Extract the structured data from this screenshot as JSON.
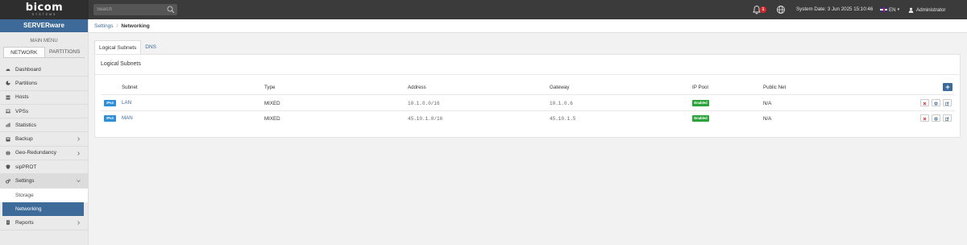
{
  "logo": {
    "main": "bicom",
    "sub": "SYSTEMS"
  },
  "search": {
    "placeholder": "Search"
  },
  "notifications": {
    "count": "1"
  },
  "system_date": "System Date: 3 Jun 2025 15:10:46",
  "language": {
    "label": "EN"
  },
  "user": {
    "name": "Administrator"
  },
  "sidebar": {
    "brand": "SERVERware",
    "main_menu": "MAIN MENU",
    "tabs": [
      {
        "label": "NETWORK"
      },
      {
        "label": "PARTITIONS"
      }
    ],
    "items": [
      {
        "label": "Dashboard",
        "icon": "dashboard-icon"
      },
      {
        "label": "Partitions",
        "icon": "pie-icon"
      },
      {
        "label": "Hosts",
        "icon": "server-icon"
      },
      {
        "label": "VPSs",
        "icon": "laptop-icon"
      },
      {
        "label": "Statistics",
        "icon": "chart-icon"
      },
      {
        "label": "Backup",
        "icon": "backup-icon"
      },
      {
        "label": "Geo-Redundancy",
        "icon": "globe-icon"
      },
      {
        "label": "sipPROT",
        "icon": "shield-icon"
      },
      {
        "label": "Settings",
        "icon": "gears-icon"
      },
      {
        "label": "Reports",
        "icon": "report-icon"
      }
    ],
    "settings_sub": [
      {
        "label": "Storage"
      },
      {
        "label": "Networking"
      }
    ]
  },
  "breadcrumb": {
    "parent": "Settings",
    "current": "Networking"
  },
  "tabs": [
    {
      "label": "Logical Subnets"
    },
    {
      "label": "DNS"
    }
  ],
  "panel": {
    "title": "Logical Subnets",
    "columns": {
      "subnet": "Subnet",
      "type": "Type",
      "address": "Address",
      "gateway": "Gateway",
      "ip_pool": "IP Pool",
      "public_net": "Public Net"
    },
    "rows": [
      {
        "badge": "IPv4",
        "subnet": "LAN",
        "type": "MIXED",
        "address": "10.1.0.0/16",
        "gateway": "10.1.0.6",
        "ip_pool": "Enabled",
        "public_net": "N/A"
      },
      {
        "badge": "IPv4",
        "subnet": "MAN",
        "type": "MIXED",
        "address": "45.10.1.0/16",
        "gateway": "45.10.1.5",
        "ip_pool": "Enabled",
        "public_net": "N/A"
      }
    ],
    "add_label": "+"
  },
  "colors": {
    "accent": "#3d6a99",
    "success": "#2aa33b",
    "ipv4": "#2e8ed8",
    "danger": "#d9262a",
    "topbar": "#3b3b3b"
  }
}
